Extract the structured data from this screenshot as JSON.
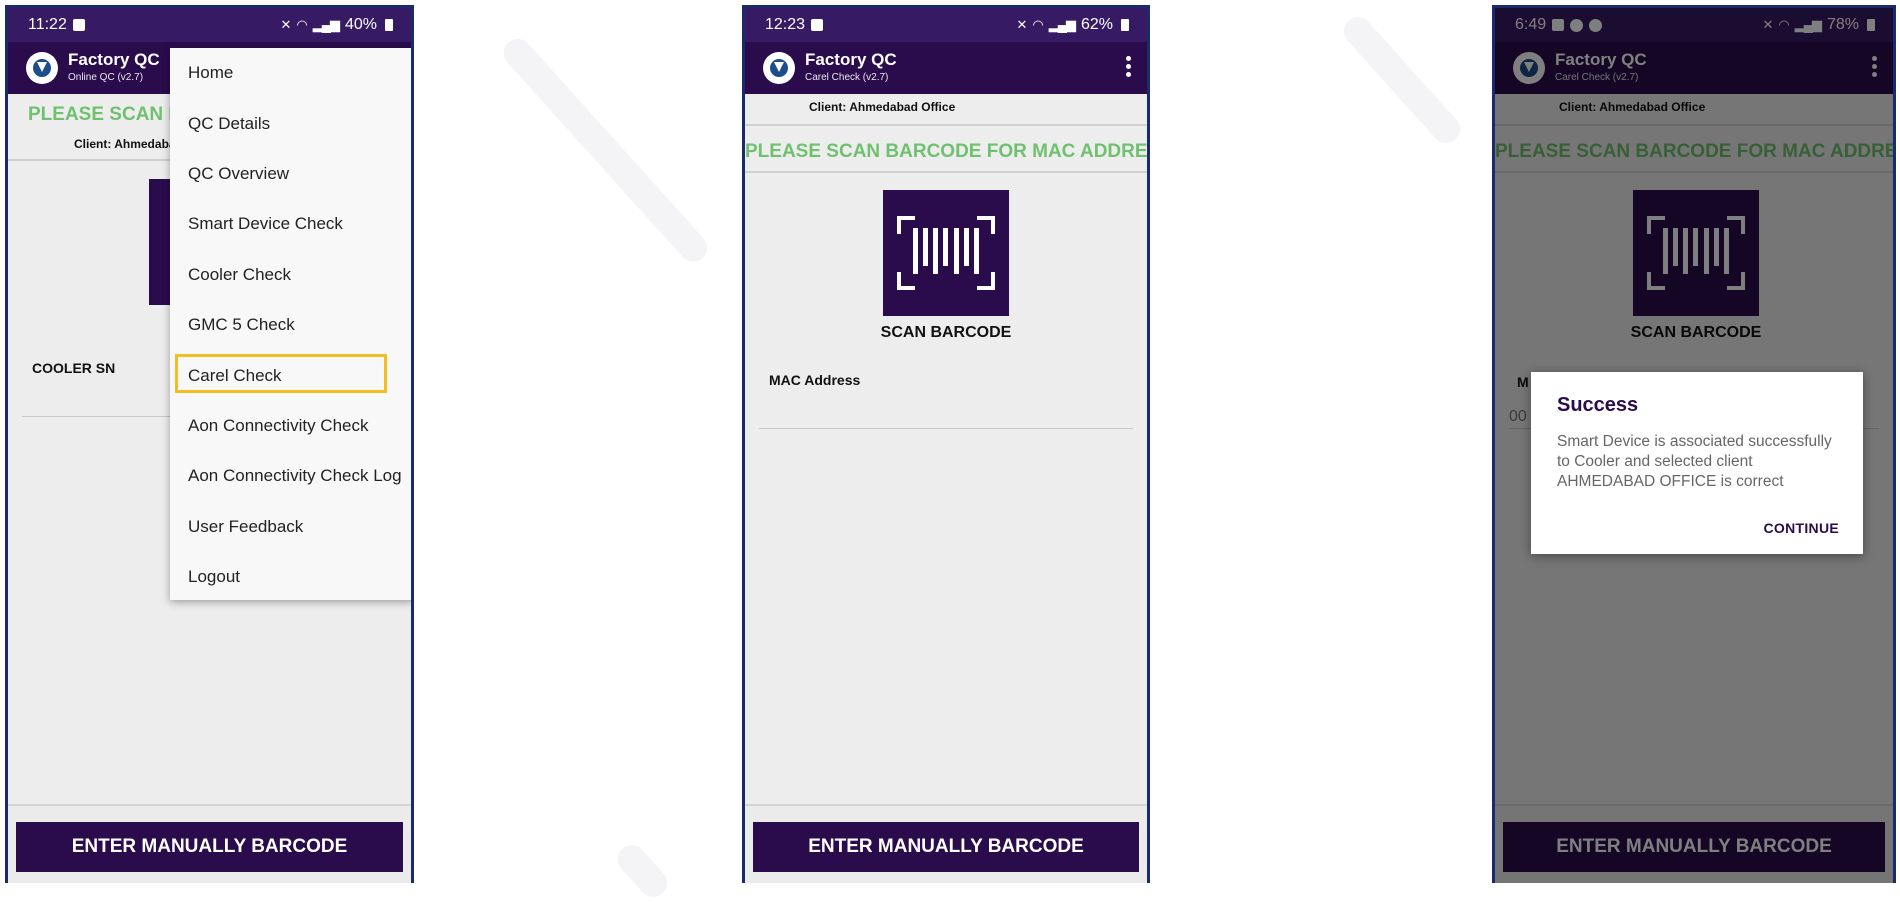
{
  "phones": [
    {
      "status": {
        "time": "11:22",
        "battery": "40%"
      },
      "app": {
        "title": "Factory QC",
        "subtitle": "Online QC (v2.7)"
      },
      "client": "Client: Ahmedabad Office",
      "scan_title": "PLEASE SCAN BARCODE FOR COOLER SN",
      "scan_label": "SCAN BARCODE",
      "field_label": "COOLER SN",
      "button": "ENTER MANUALLY BARCODE",
      "menu": {
        "items": [
          "Home",
          "QC Details",
          "QC Overview",
          "Smart Device Check",
          "Cooler Check",
          "GMC 5 Check",
          "Carel Check",
          "Aon Connectivity Check",
          "Aon Connectivity Check Log",
          "User Feedback",
          "Logout"
        ],
        "highlighted": "Carel Check"
      }
    },
    {
      "status": {
        "time": "12:23",
        "battery": "62%"
      },
      "app": {
        "title": "Factory QC",
        "subtitle": "Carel Check (v2.7)"
      },
      "client": "Client: Ahmedabad Office",
      "scan_title": "PLEASE SCAN BARCODE FOR MAC ADDRESS",
      "scan_label": "SCAN BARCODE",
      "field_label": "MAC Address",
      "button": "ENTER MANUALLY BARCODE"
    },
    {
      "status": {
        "time": "6:49",
        "battery": "78%"
      },
      "app": {
        "title": "Factory QC",
        "subtitle": "Carel Check (v2.7)"
      },
      "client": "Client: Ahmedabad Office",
      "scan_title": "PLEASE SCAN BARCODE FOR MAC ADDRESS",
      "scan_label": "SCAN BARCODE",
      "field_label": "M",
      "field_value": "00",
      "button": "ENTER MANUALLY BARCODE",
      "dialog": {
        "title": "Success",
        "message": "Smart Device is associated successfully to Cooler and selected client AHMEDABAD OFFICE is correct",
        "button": "CONTINUE"
      }
    }
  ],
  "colors": {
    "primary": "#2a0c4d",
    "statusbar": "#371a64",
    "scan_title": "#6fc16f",
    "highlight": "#f2be22",
    "frame": "#1b2a6b"
  }
}
